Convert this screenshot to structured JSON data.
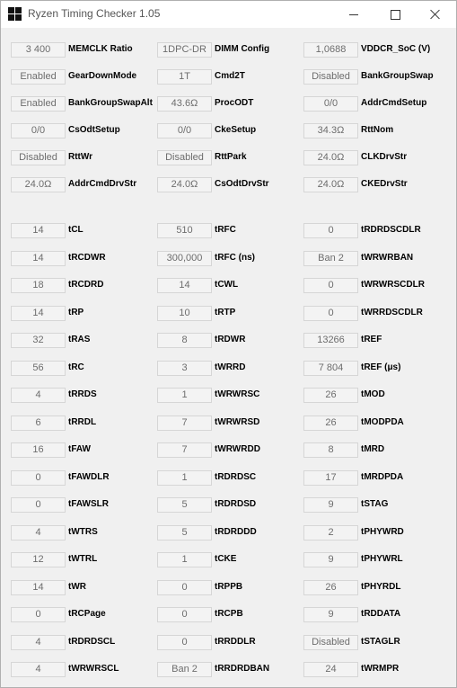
{
  "window": {
    "title": "Ryzen Timing Checker 1.05",
    "min_icon": "minimize-icon",
    "max_icon": "maximize-icon",
    "close_icon": "close-icon"
  },
  "config": [
    [
      {
        "value": "3 400",
        "label": "MEMCLK Ratio"
      },
      {
        "value": "1DPC-DR",
        "label": "DIMM Config"
      },
      {
        "value": "1,0688",
        "label": "VDDCR_SoC (V)"
      }
    ],
    [
      {
        "value": "Enabled",
        "label": "GearDownMode"
      },
      {
        "value": "1T",
        "label": "Cmd2T"
      },
      {
        "value": "Disabled",
        "label": "BankGroupSwap"
      }
    ],
    [
      {
        "value": "Enabled",
        "label": "BankGroupSwapAlt"
      },
      {
        "value": "43.6Ω",
        "label": "ProcODT"
      },
      {
        "value": "0/0",
        "label": "AddrCmdSetup"
      }
    ],
    [
      {
        "value": "0/0",
        "label": "CsOdtSetup"
      },
      {
        "value": "0/0",
        "label": "CkeSetup"
      },
      {
        "value": "34.3Ω",
        "label": "RttNom"
      }
    ],
    [
      {
        "value": "Disabled",
        "label": "RttWr"
      },
      {
        "value": "Disabled",
        "label": "RttPark"
      },
      {
        "value": "24.0Ω",
        "label": "CLKDrvStr"
      }
    ],
    [
      {
        "value": "24.0Ω",
        "label": "AddrCmdDrvStr"
      },
      {
        "value": "24.0Ω",
        "label": "CsOdtDrvStr"
      },
      {
        "value": "24.0Ω",
        "label": "CKEDrvStr"
      }
    ]
  ],
  "timings": [
    [
      {
        "value": "14",
        "label": "tCL"
      },
      {
        "value": "510",
        "label": "tRFC"
      },
      {
        "value": "0",
        "label": "tRDRDSCDLR"
      }
    ],
    [
      {
        "value": "14",
        "label": "tRCDWR"
      },
      {
        "value": "300,000",
        "label": "tRFC (ns)"
      },
      {
        "value": "Ban 2",
        "label": "tWRWRBAN"
      }
    ],
    [
      {
        "value": "18",
        "label": "tRCDRD"
      },
      {
        "value": "14",
        "label": "tCWL"
      },
      {
        "value": "0",
        "label": "tWRWRSCDLR"
      }
    ],
    [
      {
        "value": "14",
        "label": "tRP"
      },
      {
        "value": "10",
        "label": "tRTP"
      },
      {
        "value": "0",
        "label": "tWRRDSCDLR"
      }
    ],
    [
      {
        "value": "32",
        "label": "tRAS"
      },
      {
        "value": "8",
        "label": "tRDWR"
      },
      {
        "value": "13266",
        "label": "tREF"
      }
    ],
    [
      {
        "value": "56",
        "label": "tRC"
      },
      {
        "value": "3",
        "label": "tWRRD"
      },
      {
        "value": "7 804",
        "label": "tREF (μs)"
      }
    ],
    [
      {
        "value": "4",
        "label": "tRRDS"
      },
      {
        "value": "1",
        "label": "tWRWRSC"
      },
      {
        "value": "26",
        "label": "tMOD"
      }
    ],
    [
      {
        "value": "6",
        "label": "tRRDL"
      },
      {
        "value": "7",
        "label": "tWRWRSD"
      },
      {
        "value": "26",
        "label": "tMODPDA"
      }
    ],
    [
      {
        "value": "16",
        "label": "tFAW"
      },
      {
        "value": "7",
        "label": "tWRWRDD"
      },
      {
        "value": "8",
        "label": "tMRD"
      }
    ],
    [
      {
        "value": "0",
        "label": "tFAWDLR"
      },
      {
        "value": "1",
        "label": "tRDRDSC"
      },
      {
        "value": "17",
        "label": "tMRDPDA"
      }
    ],
    [
      {
        "value": "0",
        "label": "tFAWSLR"
      },
      {
        "value": "5",
        "label": "tRDRDSD"
      },
      {
        "value": "9",
        "label": "tSTAG"
      }
    ],
    [
      {
        "value": "4",
        "label": "tWTRS"
      },
      {
        "value": "5",
        "label": "tRDRDDD"
      },
      {
        "value": "2",
        "label": "tPHYWRD"
      }
    ],
    [
      {
        "value": "12",
        "label": "tWTRL"
      },
      {
        "value": "1",
        "label": "tCKE"
      },
      {
        "value": "9",
        "label": "tPHYWRL"
      }
    ],
    [
      {
        "value": "14",
        "label": "tWR"
      },
      {
        "value": "0",
        "label": "tRPPB"
      },
      {
        "value": "26",
        "label": "tPHYRDL"
      }
    ],
    [
      {
        "value": "0",
        "label": "tRCPage"
      },
      {
        "value": "0",
        "label": "tRCPB"
      },
      {
        "value": "9",
        "label": "tRDDATA"
      }
    ],
    [
      {
        "value": "4",
        "label": "tRDRDSCL"
      },
      {
        "value": "0",
        "label": "tRRDDLR"
      },
      {
        "value": "Disabled",
        "label": "tSTAGLR"
      }
    ],
    [
      {
        "value": "4",
        "label": "tWRWRSCL"
      },
      {
        "value": "Ban 2",
        "label": "tRRDRDBAN"
      },
      {
        "value": "24",
        "label": "tWRMPR"
      }
    ]
  ]
}
